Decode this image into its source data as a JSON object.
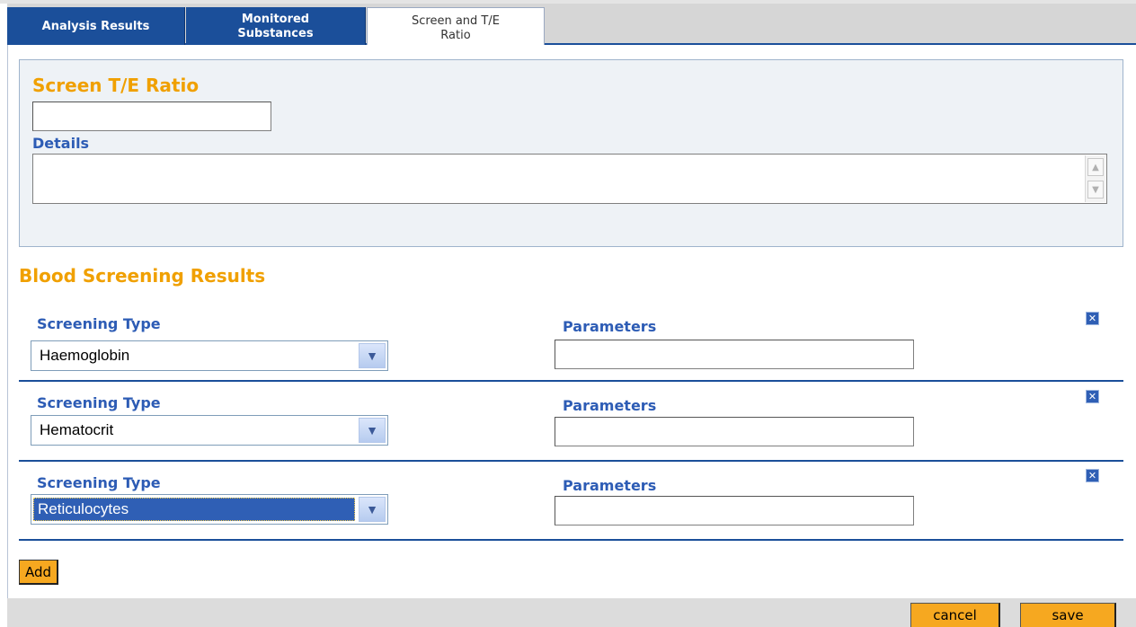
{
  "tabs": [
    {
      "label": "Analysis Results",
      "active": false
    },
    {
      "label": "Monitored\nSubstances",
      "active": false
    },
    {
      "label": "Screen and T/E\nRatio",
      "active": true
    }
  ],
  "te_section": {
    "title": "Screen T/E Ratio",
    "ratio_value": "",
    "details_label": "Details",
    "details_value": ""
  },
  "blood": {
    "title": "Blood Screening Results",
    "rows": [
      {
        "type_label": "Screening Type",
        "type_value": "Haemoglobin",
        "params_label": "Parameters",
        "params_value": ""
      },
      {
        "type_label": "Screening Type",
        "type_value": "Hematocrit",
        "params_label": "Parameters",
        "params_value": ""
      },
      {
        "type_label": "Screening Type",
        "type_value": "Reticulocytes",
        "params_label": "Parameters",
        "params_value": ""
      }
    ],
    "add_label": "Add"
  },
  "footer": {
    "cancel_label": "cancel",
    "save_label": "save"
  },
  "colors": {
    "accent_blue": "#1b4f9a",
    "heading_orange": "#f0a000",
    "button_orange": "#f6a820"
  }
}
